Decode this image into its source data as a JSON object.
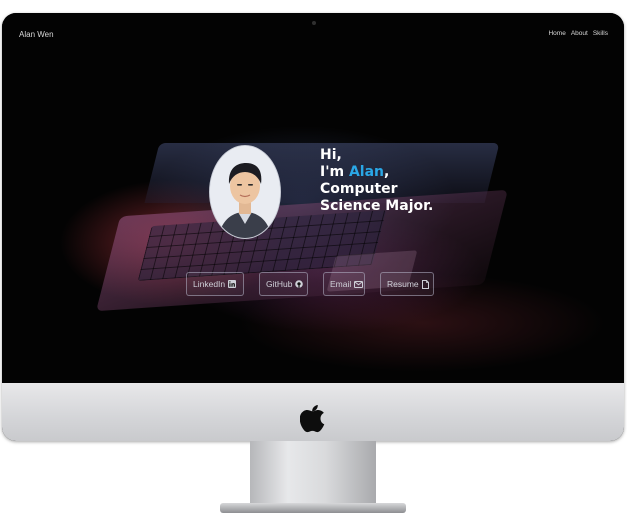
{
  "site": {
    "name": "Alan Wen"
  },
  "nav": {
    "items": [
      "Home",
      "About",
      "Skills"
    ]
  },
  "hero": {
    "greeting": "Hi,",
    "intro_prefix": "I'm ",
    "intro_name": "Alan",
    "intro_suffix": ",",
    "line3": "Computer",
    "line4": "Science Major."
  },
  "buttons": {
    "linkedin": "LinkedIn",
    "github": "GitHub",
    "email": "Email",
    "resume": "Resume"
  },
  "icons": {
    "linkedin": "linkedin-icon",
    "github": "github-icon",
    "email": "envelope-icon",
    "resume": "document-icon",
    "apple": "apple-logo-icon"
  },
  "colors": {
    "accent": "#2aa7e6",
    "screen_bg": "#030303",
    "text": "#ffffff"
  }
}
